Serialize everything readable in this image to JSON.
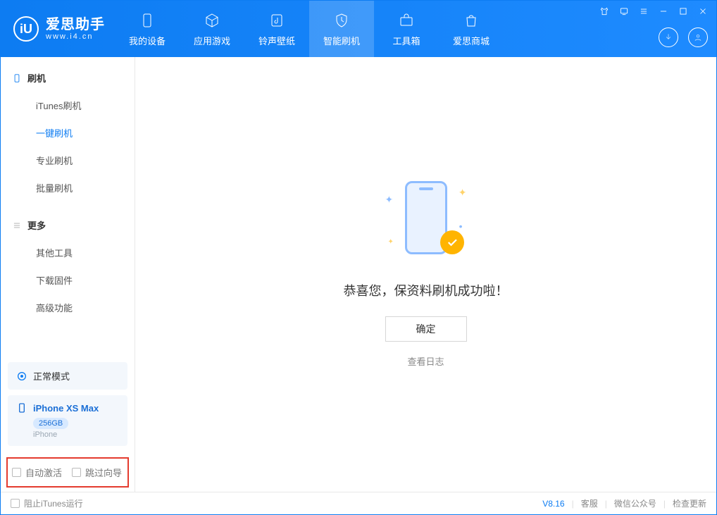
{
  "app": {
    "name_zh": "爱思助手",
    "name_en": "www.i4.cn",
    "logo_letter": "iU"
  },
  "nav": {
    "items": [
      {
        "label": "我的设备",
        "icon": "device"
      },
      {
        "label": "应用游戏",
        "icon": "cube"
      },
      {
        "label": "铃声壁纸",
        "icon": "music"
      },
      {
        "label": "智能刷机",
        "icon": "shield",
        "active": true
      },
      {
        "label": "工具箱",
        "icon": "toolbox"
      },
      {
        "label": "爱思商城",
        "icon": "bag"
      }
    ]
  },
  "sidebar": {
    "section1": {
      "title": "刷机",
      "items": [
        {
          "label": "iTunes刷机"
        },
        {
          "label": "一键刷机",
          "active": true
        },
        {
          "label": "专业刷机"
        },
        {
          "label": "批量刷机"
        }
      ]
    },
    "section2": {
      "title": "更多",
      "items": [
        {
          "label": "其他工具"
        },
        {
          "label": "下载固件"
        },
        {
          "label": "高级功能"
        }
      ]
    },
    "mode_label": "正常模式",
    "device": {
      "name": "iPhone XS Max",
      "storage": "256GB",
      "type": "iPhone"
    },
    "check1": "自动激活",
    "check2": "跳过向导"
  },
  "main": {
    "message": "恭喜您，保资料刷机成功啦！",
    "ok": "确定",
    "view_log": "查看日志"
  },
  "footer": {
    "block_itunes": "阻止iTunes运行",
    "version": "V8.16",
    "links": [
      "客服",
      "微信公众号",
      "检查更新"
    ]
  }
}
